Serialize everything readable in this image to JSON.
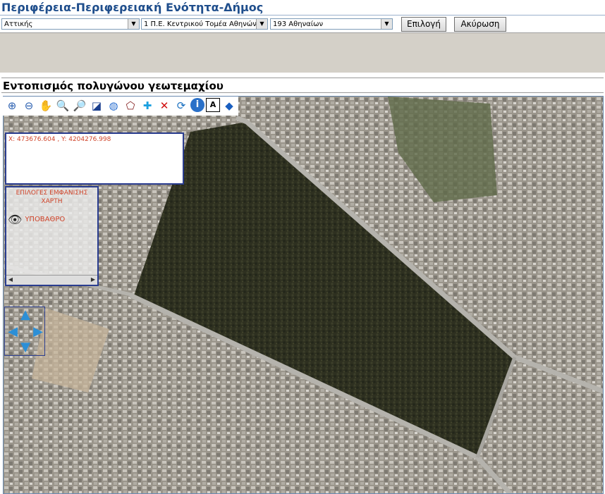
{
  "header": {
    "title": "Περιφέρεια-Περιφερειακή Ενότητα-Δήμος"
  },
  "selectors": {
    "region": "Αττικής",
    "unit": "1 Π.Ε. Κεντρικού Τομέα Αθηνών",
    "municipality": "193 Αθηναίων"
  },
  "buttons": {
    "select": "Επιλογή",
    "cancel": "Ακύρωση"
  },
  "panel": {
    "title": "Εντοπισμός πολυγώνου γεωτεμαχίου"
  },
  "map": {
    "coords": "X: 473676.604 , Y: 4204276.998",
    "options_title": "ΕΠΙΛΟΓΕΣ ΕΜΦΑΝΙΣΗΣ ΧΑΡΤΗ",
    "layer_label": "ΥΠΟΒΑΘΡΟ"
  },
  "toolbar_icons": [
    "zoom-in-box-icon",
    "zoom-out-box-icon",
    "pan-hand-icon",
    "zoom-in-icon",
    "zoom-out-icon",
    "zoom-extent-icon",
    "globe-icon",
    "polygon-icon",
    "add-point-icon",
    "delete-icon",
    "refresh-icon",
    "info-icon",
    "label-icon",
    "layers-icon"
  ],
  "colors": {
    "title": "#1f4e8c",
    "accent_red": "#d0442a",
    "frame_blue": "#2a3d8f"
  }
}
